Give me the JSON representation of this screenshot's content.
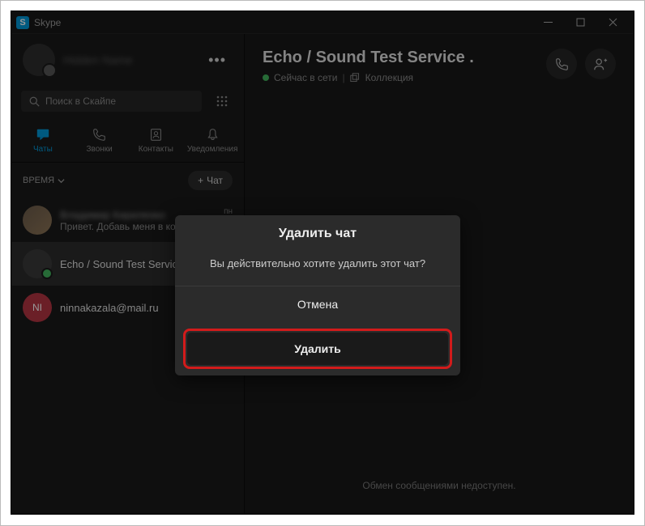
{
  "window": {
    "title": "Skype",
    "icon_letter": "S"
  },
  "profile": {
    "name": "Hidden Name"
  },
  "search": {
    "placeholder": "Поиск в Скайпе"
  },
  "nav": {
    "chats": "Чаты",
    "calls": "Звонки",
    "contacts": "Контакты",
    "notifications": "Уведомления"
  },
  "filter": {
    "label": "ВРЕМЯ",
    "new_chat": "Чат"
  },
  "chats": [
    {
      "name": "Владимир Кириленко",
      "preview": "Привет. Добавь меня в контакты...",
      "time": "пн"
    },
    {
      "name": "Echo / Sound Test Service ."
    },
    {
      "initials": "NI",
      "name": "ninnakazala@mail.ru"
    }
  ],
  "header": {
    "title": "Echo / Sound Test Service .",
    "status": "Сейчас в сети",
    "collection": "Коллекция"
  },
  "body": {
    "unavailable": "Обмен сообщениями недоступен."
  },
  "modal": {
    "title": "Удалить чат",
    "body": "Вы действительно хотите удалить этот чат?",
    "cancel": "Отмена",
    "delete": "Удалить"
  }
}
